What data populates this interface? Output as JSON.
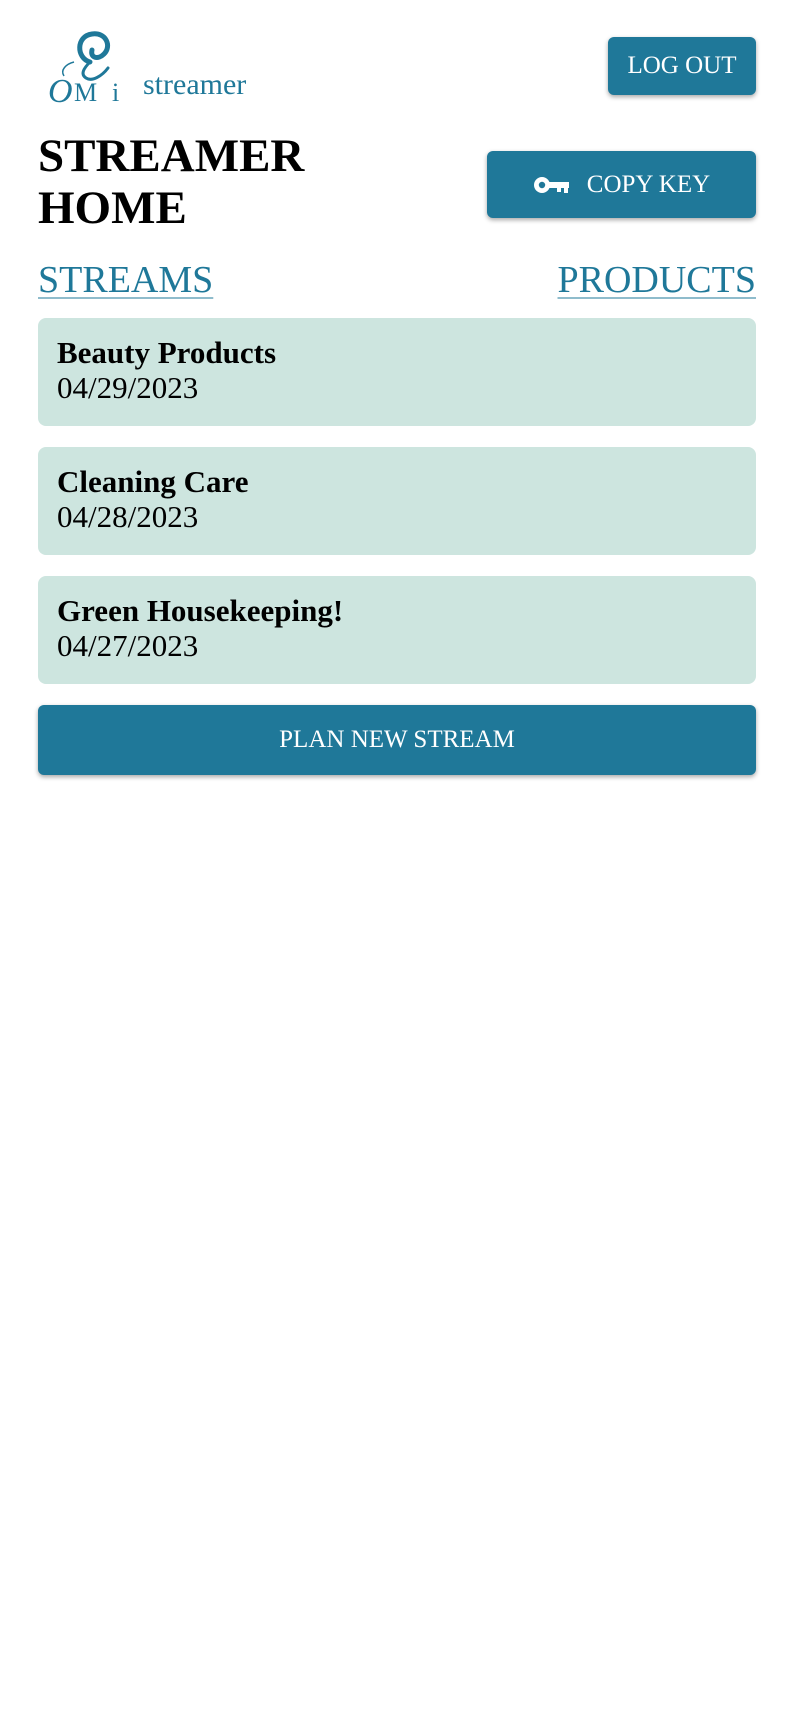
{
  "brand": {
    "name": "streamer",
    "logo_icon": "omi-swan-logo",
    "logo_text": "OMi"
  },
  "header": {
    "logout_label": "LOG OUT"
  },
  "page": {
    "title_line1": "STREAMER",
    "title_line2": "HOME",
    "copy_key_label": "COPY KEY",
    "copy_key_icon": "key-icon"
  },
  "nav": {
    "streams_label": "STREAMS",
    "products_label": "PRODUCTS"
  },
  "streams": [
    {
      "name": "Beauty Products",
      "date": "04/29/2023"
    },
    {
      "name": "Cleaning Care",
      "date": "04/28/2023"
    },
    {
      "name": "Green Housekeeping!",
      "date": "04/27/2023"
    }
  ],
  "actions": {
    "plan_new_stream_label": "PLAN NEW STREAM"
  },
  "colors": {
    "accent": "#1f7899",
    "card_background": "#cde5df",
    "text": "#000000"
  }
}
